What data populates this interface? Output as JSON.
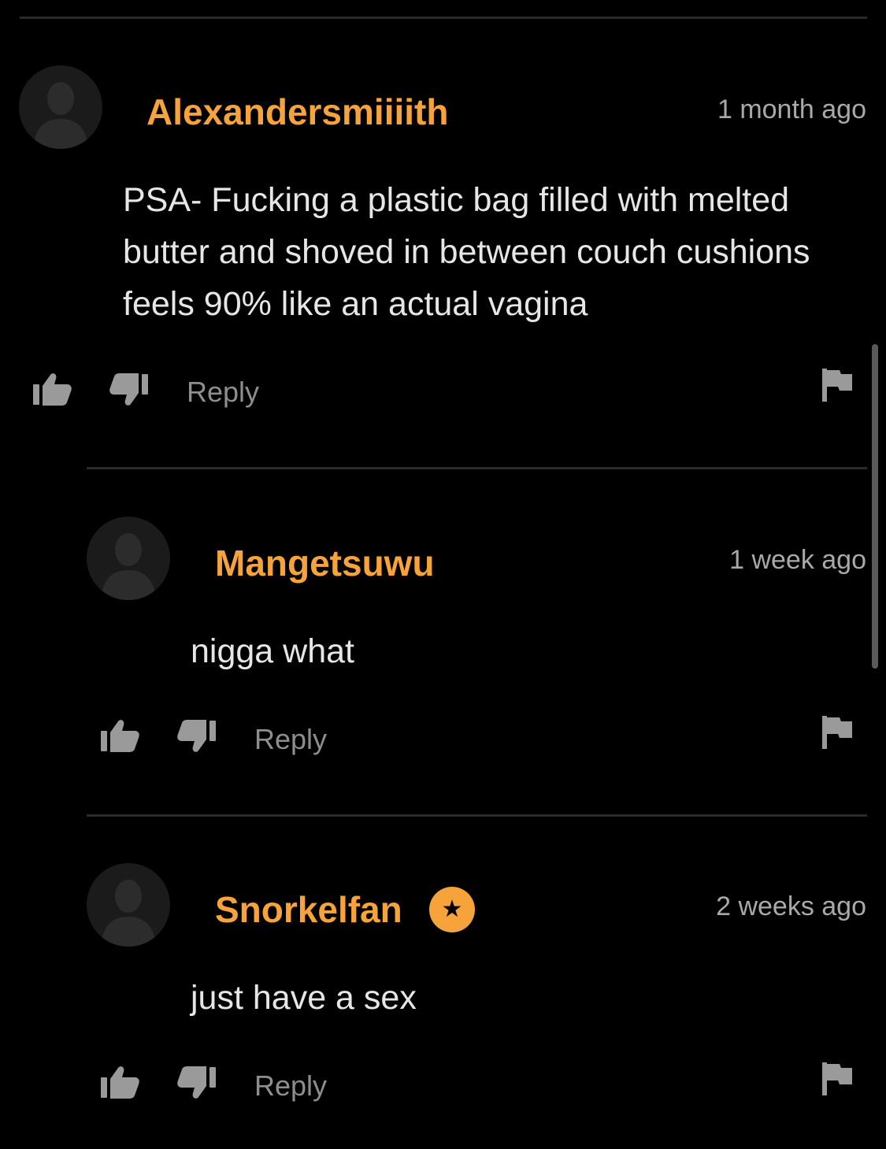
{
  "comments": [
    {
      "username": "Alexandersmiiiith",
      "time": "1 month ago",
      "text": "PSA- Fucking a plastic bag filled with melted butter and shoved in between couch cushions feels 90% like an actual vagina",
      "reply_label": "Reply"
    },
    {
      "username": "Mangetsuwu",
      "time": "1 week ago",
      "text": "nigga what",
      "reply_label": "Reply"
    },
    {
      "username": "Snorkelfan",
      "time": "2 weeks ago",
      "text": "just have a sex",
      "reply_label": "Reply",
      "badge": "★"
    }
  ],
  "colors": {
    "accent": "#f7a33b",
    "background": "#000000",
    "text": "#e6e6e6",
    "muted": "#8e8e8e"
  },
  "icons": [
    "avatar-placeholder-icon",
    "thumbs-up-icon",
    "thumbs-down-icon",
    "flag-icon",
    "star-icon"
  ]
}
